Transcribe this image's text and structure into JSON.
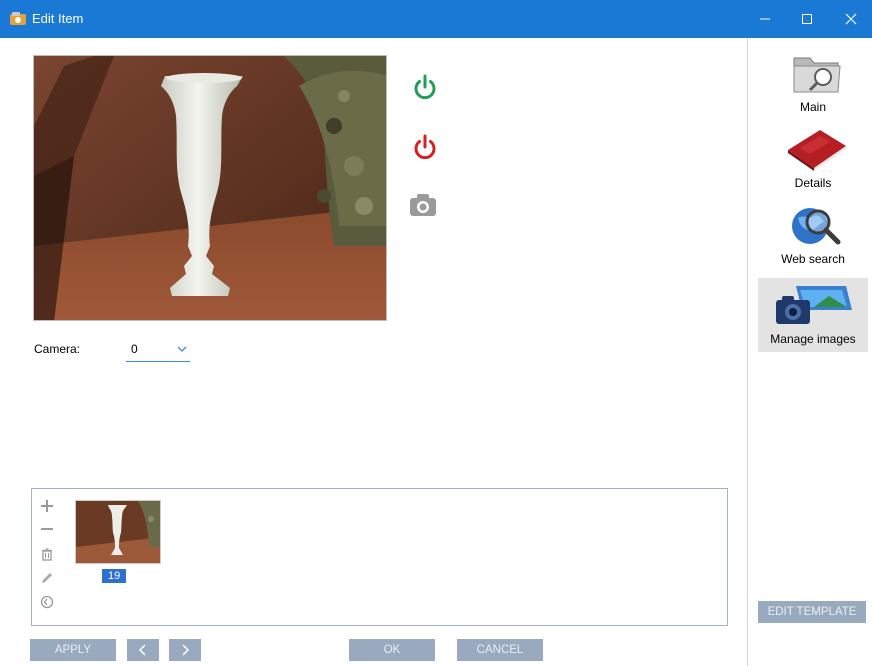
{
  "window": {
    "title": "Edit Item",
    "controls": [
      "minimize",
      "maximize",
      "close"
    ]
  },
  "camera": {
    "label": "Camera:",
    "selected": "0"
  },
  "gallery": {
    "tools": [
      "add-icon",
      "remove-icon",
      "trash-icon",
      "pencil-icon",
      "rotate-icon"
    ],
    "thumbnails": [
      {
        "label": "19"
      }
    ]
  },
  "buttons": {
    "apply": "APPLY",
    "prev": "<",
    "next": ">",
    "ok": "OK",
    "cancel": "CANCEL",
    "edit_template": "EDIT TEMPLATE"
  },
  "sidebar": {
    "items": [
      {
        "label": "Main",
        "icon": "folder-search-icon"
      },
      {
        "label": "Details",
        "icon": "book-icon"
      },
      {
        "label": "Web search",
        "icon": "globe-search-icon"
      },
      {
        "label": "Manage images",
        "icon": "camera-images-icon",
        "active": true
      }
    ]
  },
  "colors": {
    "titlebar": "#1b79d6",
    "power_on": "#1e9e57",
    "power_off": "#d42020",
    "button": "#99aabe",
    "thumb_label": "#2e6fd2"
  }
}
